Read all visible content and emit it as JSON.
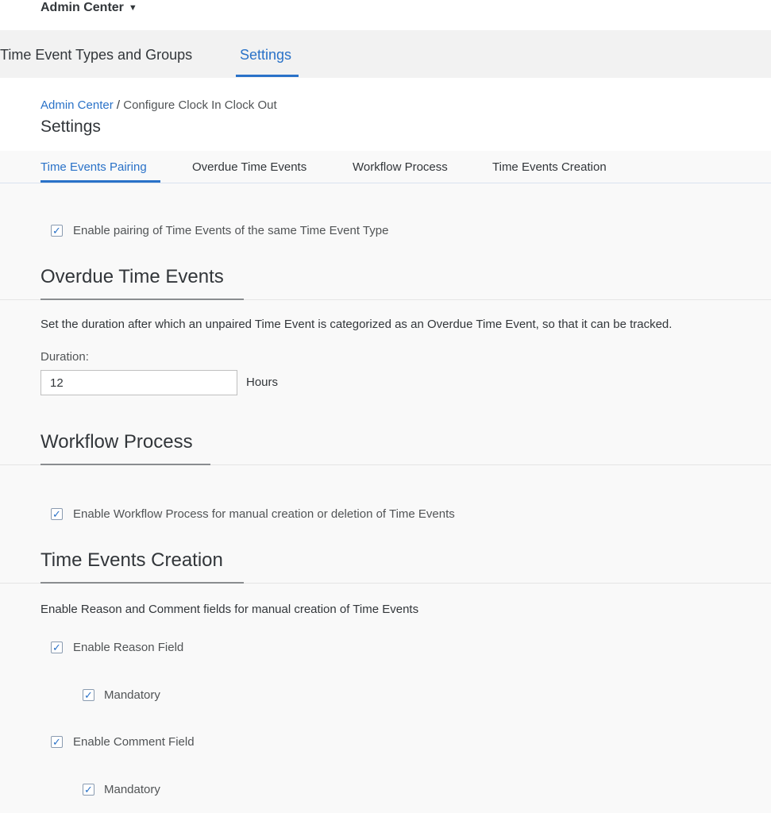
{
  "app": {
    "title": "Admin Center",
    "menu_icon": "caret-down-icon"
  },
  "main_tabs": [
    {
      "label": "Time Event Types and Groups",
      "active": false
    },
    {
      "label": "Settings",
      "active": true
    }
  ],
  "breadcrumb": {
    "link": "Admin Center",
    "separator": "/",
    "current": "Configure Clock In Clock Out"
  },
  "page_title": "Settings",
  "anchor_tabs": [
    {
      "label": "Time Events Pairing",
      "active": true
    },
    {
      "label": "Overdue Time Events",
      "active": false
    },
    {
      "label": "Workflow Process",
      "active": false
    },
    {
      "label": "Time Events Creation",
      "active": false
    }
  ],
  "pairing": {
    "checkbox_label": "Enable pairing of Time Events of the same Time Event Type",
    "checked": true
  },
  "overdue": {
    "title": "Overdue Time Events",
    "description": "Set the duration after which an unpaired Time Event is categorized as an Overdue Time Event, so that it can be tracked.",
    "duration_label": "Duration:",
    "duration_value": "12",
    "unit": "Hours"
  },
  "workflow": {
    "title": "Workflow Process",
    "checkbox_label": "Enable Workflow Process for manual creation or deletion of Time Events",
    "checked": true
  },
  "creation": {
    "title": "Time Events Creation",
    "description": "Enable Reason and Comment fields for manual creation of Time Events",
    "reason_label": "Enable Reason Field",
    "reason_mandatory_label": "Mandatory",
    "comment_label": "Enable Comment Field",
    "comment_mandatory_label": "Mandatory"
  },
  "colors": {
    "accent": "#2a72c8",
    "text": "#32363a",
    "secondary_text": "#515456"
  }
}
